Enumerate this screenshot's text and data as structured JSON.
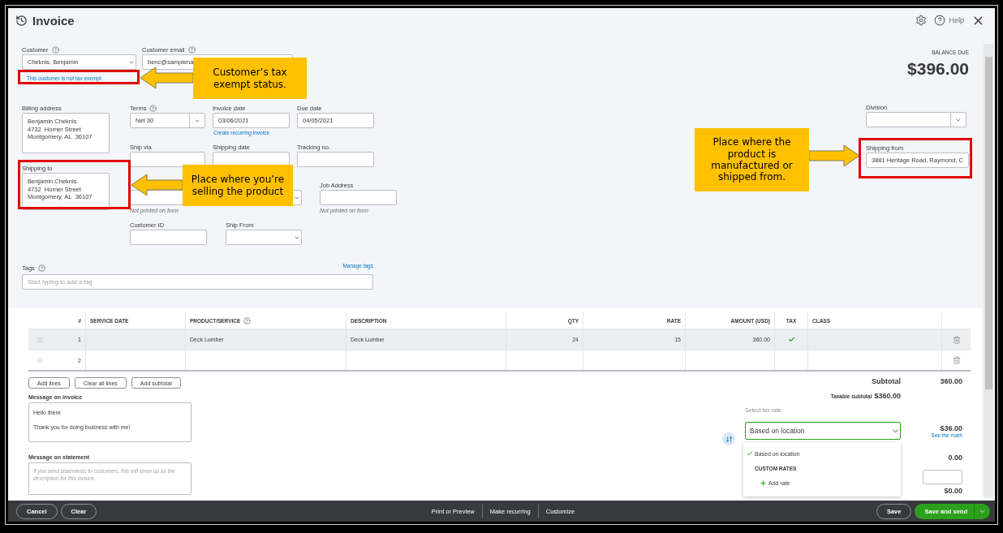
{
  "header": {
    "title": "Invoice",
    "help": "Help"
  },
  "customer": {
    "label": "Customer",
    "help": true,
    "value": "Cheknis, Benjamin",
    "tax_status": "This customer is not tax exempt"
  },
  "customer_email": {
    "label": "Customer email",
    "help": true,
    "value": "benc@samplena"
  },
  "balance_due": {
    "label": "BALANCE DUE",
    "amount": "$396.00"
  },
  "billing_address": {
    "label": "Billing address",
    "lines": [
      "Benjamin Cheknis",
      "4732  Horner Street",
      "Montgomery, AL  36107"
    ]
  },
  "shipping_to": {
    "label": "Shipping to",
    "lines": [
      "Benjamin Cheknis",
      "4732  Horner Street",
      "Montgomery, AL  36107"
    ]
  },
  "terms": {
    "label": "Terms",
    "help": true,
    "value": "Net 30"
  },
  "invoice_date": {
    "label": "Invoice date",
    "value": "03/06/2021",
    "link": "Create recurring invoice"
  },
  "due_date": {
    "label": "Due date",
    "value": "04/05/2021"
  },
  "shipping_row": [
    {
      "label": "Ship via"
    },
    {
      "label": "Shipping date"
    },
    {
      "label": "Tracking no."
    }
  ],
  "custom_fields": [
    {
      "kind": "text",
      "note": "Not printed on form"
    },
    {
      "kind": "select"
    },
    {
      "kind": "text",
      "label": "Job Address",
      "note": "Not printed on form"
    }
  ],
  "extra_fields": [
    {
      "kind": "text",
      "label": "Customer ID"
    },
    {
      "kind": "select",
      "label": "Ship From"
    }
  ],
  "tags": {
    "label": "Tags",
    "help": true,
    "link": "Manage tags",
    "placeholder": "Start typing to add a tag"
  },
  "division": {
    "label": "Division"
  },
  "shipping_from": {
    "label": "Shipping from",
    "value": "3881  Heritage Road, Raymond, C"
  },
  "table": {
    "columns": [
      {
        "label": "#"
      },
      {
        "label": "SERVICE DATE"
      },
      {
        "label": "PRODUCT/SERVICE",
        "help": true
      },
      {
        "label": "DESCRIPTION"
      },
      {
        "label": "QTY"
      },
      {
        "label": "RATE"
      },
      {
        "label": "AMOUNT (USD)"
      },
      {
        "label": "TAX"
      },
      {
        "label": "CLASS"
      }
    ],
    "rows": [
      {
        "number": "1",
        "product": "Deck Lumber",
        "description": "Deck Lumber",
        "qty": "24",
        "rate": "15",
        "amount": "360.00",
        "taxable": true,
        "selected": true
      },
      {
        "number": "2",
        "taxable": false,
        "selected": false
      }
    ]
  },
  "line_buttons": [
    "Add lines",
    "Clear all lines",
    "Add subtotal"
  ],
  "message_invoice": {
    "label": "Message on invoice",
    "paragraphs": [
      "Hello there",
      "Thank you for doing business with me!"
    ]
  },
  "message_statement": {
    "label": "Message on statement",
    "placeholder": "If you send statements to customers, this will show up as the description for this invoice."
  },
  "totals": {
    "subtotal_label": "Subtotal",
    "subtotal": "360.00",
    "taxable_label": "Taxable subtotal",
    "taxable": "$360.00",
    "tax_rate_label": "Select tax rate",
    "tax_rate": "Based on location",
    "tax": "$36.00",
    "see_math": "See the math",
    "discount": "0.00",
    "total": "$0.00"
  },
  "tax_menu": {
    "options": [
      {
        "label": "Based on location",
        "selected": true
      }
    ],
    "section": "CUSTOM RATES",
    "add": "Add rate"
  },
  "footer": {
    "left": [
      "Cancel",
      "Clear"
    ],
    "center": [
      "Print or Preview",
      "Make recurring",
      "Customize"
    ],
    "save": "Save",
    "primary": "Save and send"
  },
  "annotations": [
    {
      "text": "Customer’s tax exempt status."
    },
    {
      "text": "Place where you’re selling the product"
    },
    {
      "text": "Place where the product is manufactured or shipped from."
    }
  ]
}
